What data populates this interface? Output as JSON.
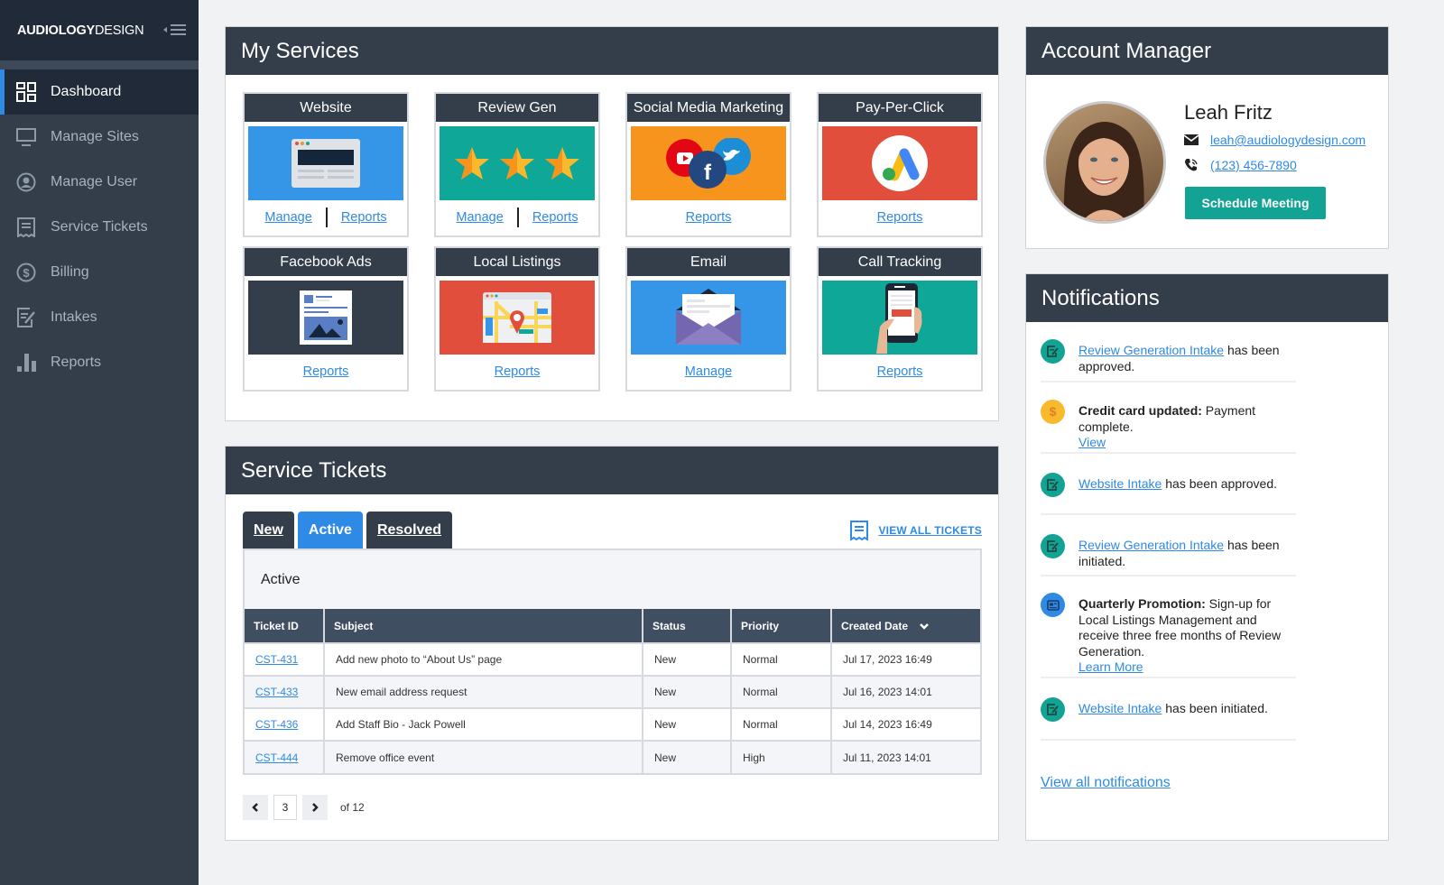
{
  "sidebar": {
    "logo_bold": "AUDIOLOGY",
    "logo_light": "DESIGN",
    "items": [
      {
        "label": "Dashboard",
        "icon": "dashboard-icon",
        "active": true
      },
      {
        "label": "Manage Sites",
        "icon": "monitor-icon"
      },
      {
        "label": "Manage User",
        "icon": "user-circle-icon"
      },
      {
        "label": "Service Tickets",
        "icon": "receipt-icon"
      },
      {
        "label": "Billing",
        "icon": "dollar-circle-icon"
      },
      {
        "label": "Intakes",
        "icon": "edit-form-icon"
      },
      {
        "label": "Reports",
        "icon": "bar-chart-icon"
      }
    ]
  },
  "services": {
    "title": "My Services",
    "cards": [
      {
        "title": "Website",
        "links": [
          "Manage",
          "Reports"
        ],
        "color": "#3596e8"
      },
      {
        "title": "Review Gen",
        "links": [
          "Manage",
          "Reports"
        ],
        "color": "#0fa797"
      },
      {
        "title": "Social Media Marketing",
        "links": [
          "Reports"
        ],
        "color": "#f7941d"
      },
      {
        "title": "Pay-Per-Click",
        "links": [
          "Reports"
        ],
        "color": "#e14e3b"
      },
      {
        "title": "Facebook Ads",
        "links": [
          "Reports"
        ],
        "color": "#343e4b"
      },
      {
        "title": "Local Listings",
        "links": [
          "Reports"
        ],
        "color": "#e14e3b"
      },
      {
        "title": "Email",
        "links": [
          "Manage"
        ],
        "color": "#3596e8"
      },
      {
        "title": "Call Tracking",
        "links": [
          "Reports"
        ],
        "color": "#0fa797"
      }
    ]
  },
  "tickets": {
    "title": "Service Tickets",
    "tabs": [
      {
        "label": "New",
        "active": false
      },
      {
        "label": "Active",
        "active": true
      },
      {
        "label": "Resolved",
        "active": false
      }
    ],
    "view_all": "VIEW ALL TICKETS",
    "caption": "Active",
    "columns": [
      "Ticket ID",
      "Subject",
      "Status",
      "Priority",
      "Created Date"
    ],
    "rows": [
      {
        "id": "CST-431",
        "subject": "Add new photo to “About Us” page",
        "status": "New",
        "priority": "Normal",
        "date": "Jul 17, 2023 16:49"
      },
      {
        "id": "CST-433",
        "subject": "New email address request",
        "status": "New",
        "priority": "Normal",
        "date": "Jul 16, 2023 14:01"
      },
      {
        "id": "CST-436",
        "subject": "Add Staff Bio - Jack Powell",
        "status": "New",
        "priority": "Normal",
        "date": "Jul 14, 2023 16:49"
      },
      {
        "id": "CST-444",
        "subject": "Remove office event",
        "status": "New",
        "priority": "High",
        "date": "Jul 11, 2023 14:01"
      }
    ],
    "pager": {
      "current": "3",
      "total_label": "of 12"
    }
  },
  "account_manager": {
    "title": "Account Manager",
    "name": "Leah Fritz",
    "email": "leah@audiologydesign.com",
    "phone": "(123) 456-7890",
    "button": "Schedule Meeting"
  },
  "notifications": {
    "title": "Notifications",
    "items": [
      {
        "icon": "intake-icon",
        "color": "#12a394",
        "link": "Review Generation Intake",
        "text": " has been approved."
      },
      {
        "icon": "dollar-icon",
        "color": "#f9b92d",
        "bold": "Credit card updated:",
        "text": " Payment complete.",
        "sublink": "View"
      },
      {
        "icon": "intake-icon",
        "color": "#12a394",
        "link": "Website Intake",
        "text": " has been approved."
      },
      {
        "icon": "intake-icon",
        "color": "#12a394",
        "link": "Review Generation Intake",
        "text": " has been initiated."
      },
      {
        "icon": "newspaper-icon",
        "color": "#2f8ae5",
        "bold": "Quarterly Promotion:",
        "text": " Sign-up for Local Listings Management and receive three free months of Review Generation.",
        "sublink": "Learn More"
      },
      {
        "icon": "intake-icon",
        "color": "#12a394",
        "link": "Website Intake",
        "text": " has been initiated."
      }
    ],
    "view_all": "View all notifications"
  }
}
